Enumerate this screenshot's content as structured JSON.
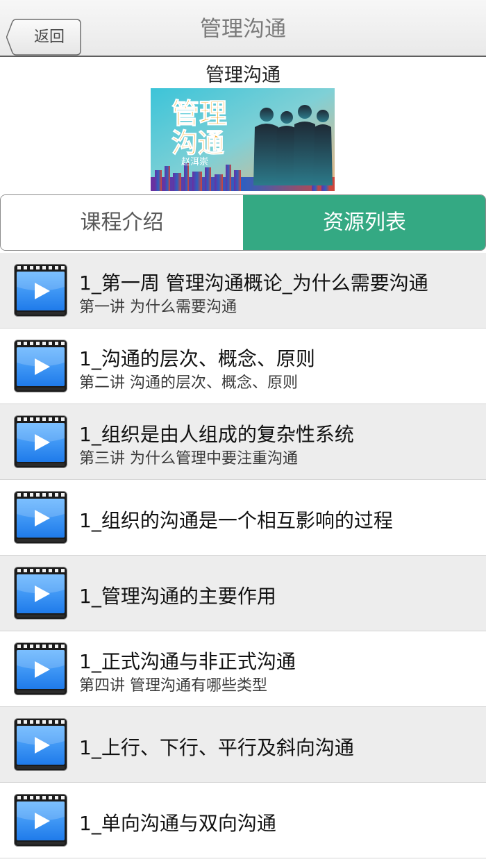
{
  "navbar": {
    "back_label": "返回",
    "title": "管理沟通"
  },
  "course": {
    "title": "管理沟通",
    "cover": {
      "title_line1": "管理",
      "title_line2": "沟通",
      "author": "赵洱崇"
    }
  },
  "tabs": {
    "intro": "课程介绍",
    "resources": "资源列表",
    "active": "resources"
  },
  "colors": {
    "accent": "#34a983",
    "row_alt": "#ededed"
  },
  "items": [
    {
      "title": "1_第一周 管理沟通概论_为什么需要沟通",
      "subtitle": "第一讲 为什么需要沟通",
      "icon": "video-icon"
    },
    {
      "title": "1_沟通的层次、概念、原则",
      "subtitle": "第二讲 沟通的层次、概念、原则",
      "icon": "video-icon"
    },
    {
      "title": "1_组织是由人组成的复杂性系统",
      "subtitle": "第三讲 为什么管理中要注重沟通",
      "icon": "video-icon"
    },
    {
      "title": "1_组织的沟通是一个相互影响的过程",
      "subtitle": "",
      "icon": "video-icon"
    },
    {
      "title": "1_管理沟通的主要作用",
      "subtitle": "",
      "icon": "video-icon"
    },
    {
      "title": "1_正式沟通与非正式沟通",
      "subtitle": "第四讲 管理沟通有哪些类型",
      "icon": "video-icon"
    },
    {
      "title": "1_上行、下行、平行及斜向沟通",
      "subtitle": "",
      "icon": "video-icon"
    },
    {
      "title": "1_单向沟通与双向沟通",
      "subtitle": "",
      "icon": "video-icon"
    }
  ]
}
